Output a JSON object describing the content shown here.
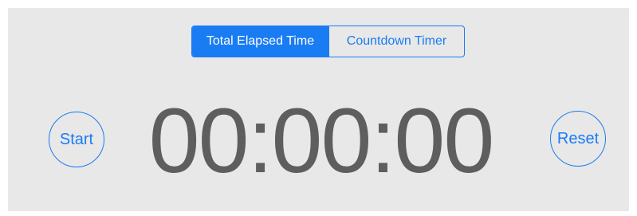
{
  "mode_selector": {
    "options": [
      {
        "label": "Total Elapsed Time",
        "selected": true
      },
      {
        "label": "Countdown Timer",
        "selected": false
      }
    ]
  },
  "controls": {
    "start_label": "Start",
    "reset_label": "Reset"
  },
  "display": {
    "time": "00:00:00"
  },
  "colors": {
    "accent": "#1a7cf3",
    "panel_background": "#e8e8e8",
    "time_text": "#5e5e5e"
  }
}
